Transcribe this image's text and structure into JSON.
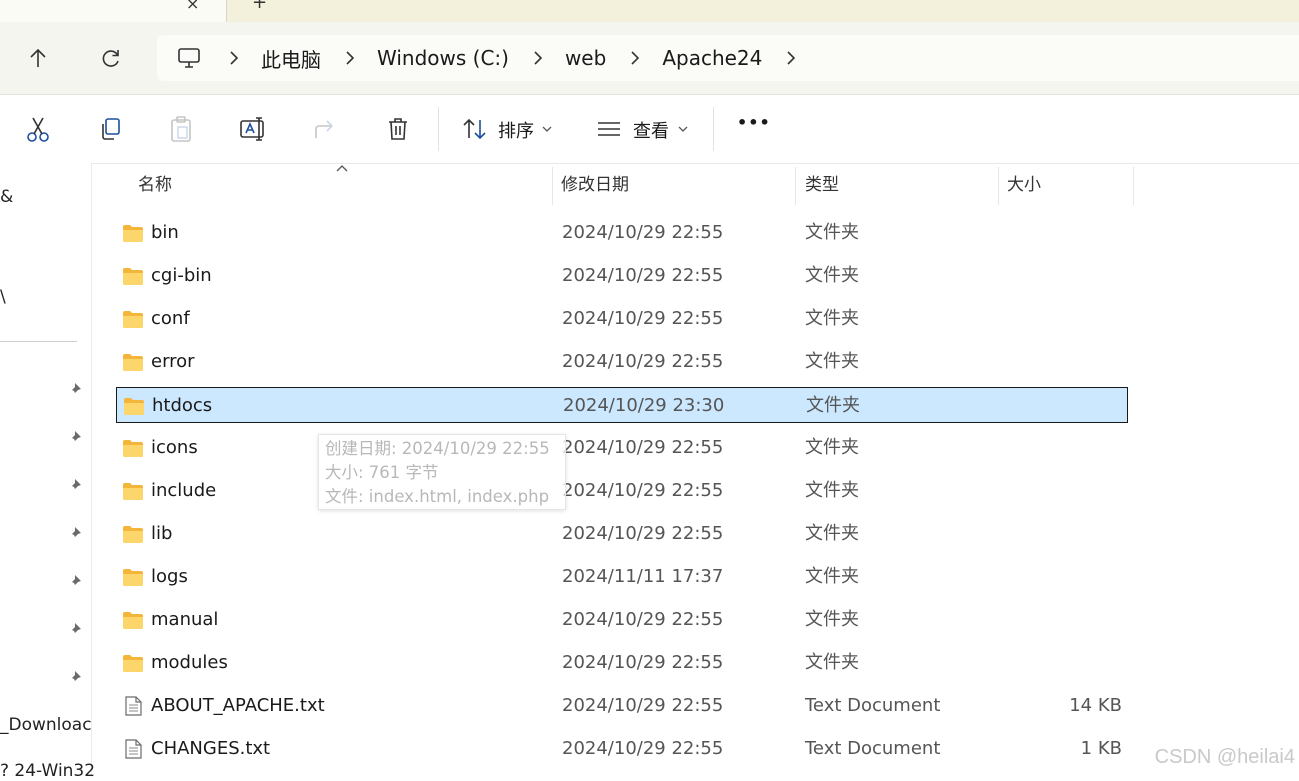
{
  "tabs": {
    "close_glyph": "×",
    "new_glyph": "+"
  },
  "address": {
    "crumbs": [
      "此电脑",
      "Windows (C:)",
      "web",
      "Apache24"
    ]
  },
  "toolbar": {
    "sort_label": "排序",
    "view_label": "查看",
    "more_label": "•••"
  },
  "sidebar": {
    "fragments": [
      "&",
      "\\",
      "_Downloac",
      "? 24-Win32"
    ]
  },
  "columns": {
    "name": "名称",
    "modified": "修改日期",
    "type": "类型",
    "size": "大小"
  },
  "files": [
    {
      "name": "bin",
      "modified": "2024/10/29 22:55",
      "type": "文件夹",
      "size": "",
      "kind": "folder"
    },
    {
      "name": "cgi-bin",
      "modified": "2024/10/29 22:55",
      "type": "文件夹",
      "size": "",
      "kind": "folder"
    },
    {
      "name": "conf",
      "modified": "2024/10/29 22:55",
      "type": "文件夹",
      "size": "",
      "kind": "folder"
    },
    {
      "name": "error",
      "modified": "2024/10/29 22:55",
      "type": "文件夹",
      "size": "",
      "kind": "folder"
    },
    {
      "name": "htdocs",
      "modified": "2024/10/29 23:30",
      "type": "文件夹",
      "size": "",
      "kind": "folder",
      "selected": true
    },
    {
      "name": "icons",
      "modified": "2024/10/29 22:55",
      "type": "文件夹",
      "size": "",
      "kind": "folder"
    },
    {
      "name": "include",
      "modified": "2024/10/29 22:55",
      "type": "文件夹",
      "size": "",
      "kind": "folder"
    },
    {
      "name": "lib",
      "modified": "2024/10/29 22:55",
      "type": "文件夹",
      "size": "",
      "kind": "folder"
    },
    {
      "name": "logs",
      "modified": "2024/11/11 17:37",
      "type": "文件夹",
      "size": "",
      "kind": "folder"
    },
    {
      "name": "manual",
      "modified": "2024/10/29 22:55",
      "type": "文件夹",
      "size": "",
      "kind": "folder"
    },
    {
      "name": "modules",
      "modified": "2024/10/29 22:55",
      "type": "文件夹",
      "size": "",
      "kind": "folder"
    },
    {
      "name": "ABOUT_APACHE.txt",
      "modified": "2024/10/29 22:55",
      "type": "Text Document",
      "size": "14 KB",
      "kind": "text"
    },
    {
      "name": "CHANGES.txt",
      "modified": "2024/10/29 22:55",
      "type": "Text Document",
      "size": "1 KB",
      "kind": "text"
    }
  ],
  "tooltip": {
    "created": "创建日期: 2024/10/29 22:55",
    "size": "大小: 761 字节",
    "files": "文件: index.html, index.php"
  },
  "watermark": "CSDN @heilai4",
  "colors": {
    "selection_bg": "#cce8ff",
    "folder_yellow": "#f7c948",
    "nav_bg": "#f5f5f0",
    "tab_bg": "#f3f0dc"
  }
}
